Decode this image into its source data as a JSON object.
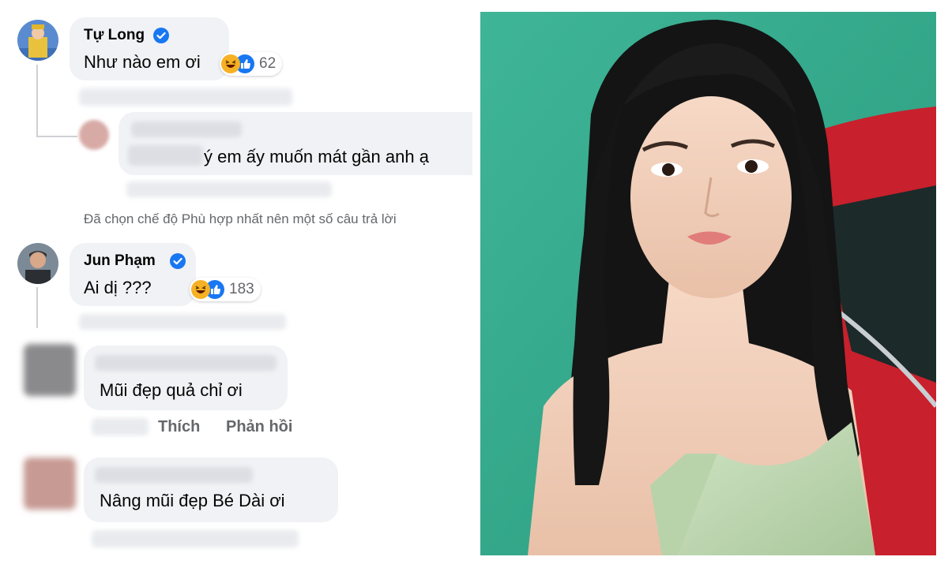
{
  "comments": [
    {
      "author": "Tự Long",
      "verified": true,
      "text": "Như nào em ơi",
      "reaction_count": "62",
      "avatar": "avatar-tu-long"
    },
    {
      "author": "",
      "verified": false,
      "text": "ý em ấy muốn mát gần anh ạ",
      "avatar": "avatar-blurred"
    },
    {
      "author": "Jun Phạm",
      "verified": true,
      "text": "Ai dị ???",
      "reaction_count": "183",
      "avatar": "avatar-jun-pham"
    },
    {
      "author": "",
      "verified": false,
      "text": "Mũi đẹp quả chỉ ơi",
      "avatar": "avatar-blurred"
    },
    {
      "author": "",
      "verified": false,
      "text": "Nâng mũi đẹp Bé Dài ơi",
      "avatar": "avatar-blurred"
    }
  ],
  "actions": {
    "like": "Thích",
    "reply": "Phản hồi"
  },
  "notice": "Đã chọn chế độ Phù hợp nhất nên một số câu trả lời",
  "icons": {
    "verified": "verified-badge-icon",
    "haha": "haha-reaction-icon",
    "like": "like-reaction-icon"
  },
  "colors": {
    "bubble": "#f0f2f5",
    "verified": "#1877f2",
    "secondary_text": "#65676b",
    "photo_wall": "#33a889",
    "car": "#c8202c"
  }
}
